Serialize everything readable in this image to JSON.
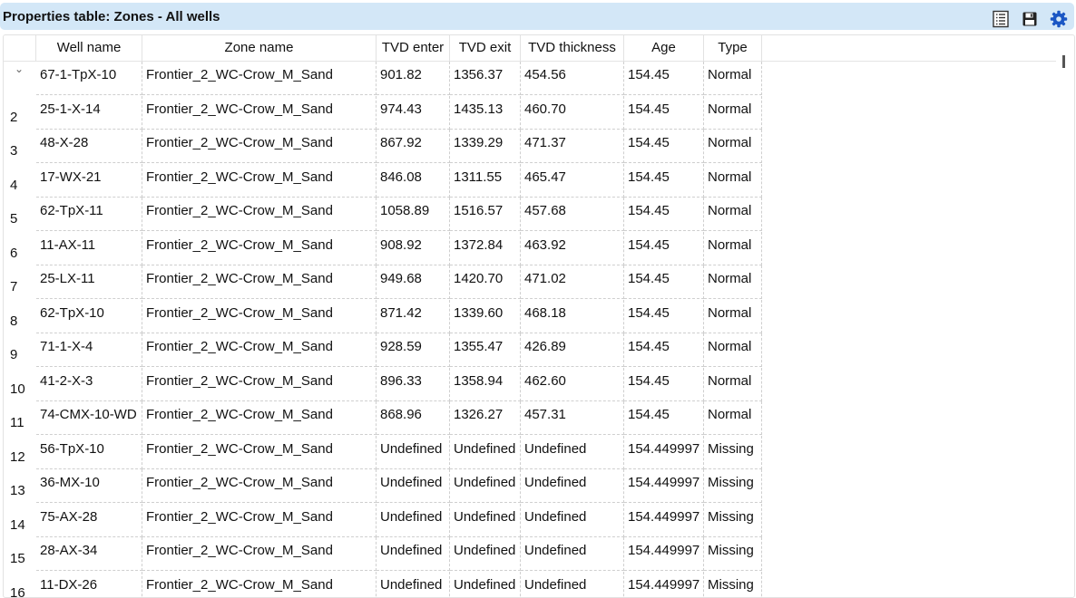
{
  "window": {
    "title": "Properties table: Zones - All wells"
  },
  "toolbar": {
    "icons": [
      "table-view-icon",
      "save-icon",
      "settings-gear-icon"
    ],
    "accent_color": "#1a56c4"
  },
  "table": {
    "columns": [
      "Well name",
      "Zone name",
      "TVD enter",
      "TVD exit",
      "TVD thickness",
      "Age",
      "Type"
    ],
    "rows": [
      {
        "num": "",
        "well": "67-1-TpX-10",
        "zone": "Frontier_2_WC-Crow_M_Sand",
        "tvd_enter": "901.82",
        "tvd_exit": "1356.37",
        "tvd_thickness": "454.56",
        "age": "154.45",
        "type": "Normal"
      },
      {
        "num": "2",
        "well": "25-1-X-14",
        "zone": "Frontier_2_WC-Crow_M_Sand",
        "tvd_enter": "974.43",
        "tvd_exit": "1435.13",
        "tvd_thickness": "460.70",
        "age": "154.45",
        "type": "Normal"
      },
      {
        "num": "3",
        "well": "48-X-28",
        "zone": "Frontier_2_WC-Crow_M_Sand",
        "tvd_enter": "867.92",
        "tvd_exit": "1339.29",
        "tvd_thickness": "471.37",
        "age": "154.45",
        "type": "Normal"
      },
      {
        "num": "4",
        "well": "17-WX-21",
        "zone": "Frontier_2_WC-Crow_M_Sand",
        "tvd_enter": "846.08",
        "tvd_exit": "1311.55",
        "tvd_thickness": "465.47",
        "age": "154.45",
        "type": "Normal"
      },
      {
        "num": "5",
        "well": "62-TpX-11",
        "zone": "Frontier_2_WC-Crow_M_Sand",
        "tvd_enter": "1058.89",
        "tvd_exit": "1516.57",
        "tvd_thickness": "457.68",
        "age": "154.45",
        "type": "Normal"
      },
      {
        "num": "6",
        "well": "11-AX-11",
        "zone": "Frontier_2_WC-Crow_M_Sand",
        "tvd_enter": "908.92",
        "tvd_exit": "1372.84",
        "tvd_thickness": "463.92",
        "age": "154.45",
        "type": "Normal"
      },
      {
        "num": "7",
        "well": "25-LX-11",
        "zone": "Frontier_2_WC-Crow_M_Sand",
        "tvd_enter": "949.68",
        "tvd_exit": "1420.70",
        "tvd_thickness": "471.02",
        "age": "154.45",
        "type": "Normal"
      },
      {
        "num": "8",
        "well": "62-TpX-10",
        "zone": "Frontier_2_WC-Crow_M_Sand",
        "tvd_enter": "871.42",
        "tvd_exit": "1339.60",
        "tvd_thickness": "468.18",
        "age": "154.45",
        "type": "Normal"
      },
      {
        "num": "9",
        "well": "71-1-X-4",
        "zone": "Frontier_2_WC-Crow_M_Sand",
        "tvd_enter": "928.59",
        "tvd_exit": "1355.47",
        "tvd_thickness": "426.89",
        "age": "154.45",
        "type": "Normal"
      },
      {
        "num": "10",
        "well": "41-2-X-3",
        "zone": "Frontier_2_WC-Crow_M_Sand",
        "tvd_enter": "896.33",
        "tvd_exit": "1358.94",
        "tvd_thickness": "462.60",
        "age": "154.45",
        "type": "Normal"
      },
      {
        "num": "11",
        "well": "74-CMX-10-WD",
        "zone": "Frontier_2_WC-Crow_M_Sand",
        "tvd_enter": "868.96",
        "tvd_exit": "1326.27",
        "tvd_thickness": "457.31",
        "age": "154.45",
        "type": "Normal"
      },
      {
        "num": "12",
        "well": "56-TpX-10",
        "zone": "Frontier_2_WC-Crow_M_Sand",
        "tvd_enter": "Undefined",
        "tvd_exit": "Undefined",
        "tvd_thickness": "Undefined",
        "age": "154.449997",
        "type": "Missing"
      },
      {
        "num": "13",
        "well": "36-MX-10",
        "zone": "Frontier_2_WC-Crow_M_Sand",
        "tvd_enter": "Undefined",
        "tvd_exit": "Undefined",
        "tvd_thickness": "Undefined",
        "age": "154.449997",
        "type": "Missing"
      },
      {
        "num": "14",
        "well": "75-AX-28",
        "zone": "Frontier_2_WC-Crow_M_Sand",
        "tvd_enter": "Undefined",
        "tvd_exit": "Undefined",
        "tvd_thickness": "Undefined",
        "age": "154.449997",
        "type": "Missing"
      },
      {
        "num": "15",
        "well": "28-AX-34",
        "zone": "Frontier_2_WC-Crow_M_Sand",
        "tvd_enter": "Undefined",
        "tvd_exit": "Undefined",
        "tvd_thickness": "Undefined",
        "age": "154.449997",
        "type": "Missing"
      },
      {
        "num": "16",
        "well": "11-DX-26",
        "zone": "Frontier_2_WC-Crow_M_Sand",
        "tvd_enter": "Undefined",
        "tvd_exit": "Undefined",
        "tvd_thickness": "Undefined",
        "age": "154.449997",
        "type": "Missing"
      }
    ]
  }
}
